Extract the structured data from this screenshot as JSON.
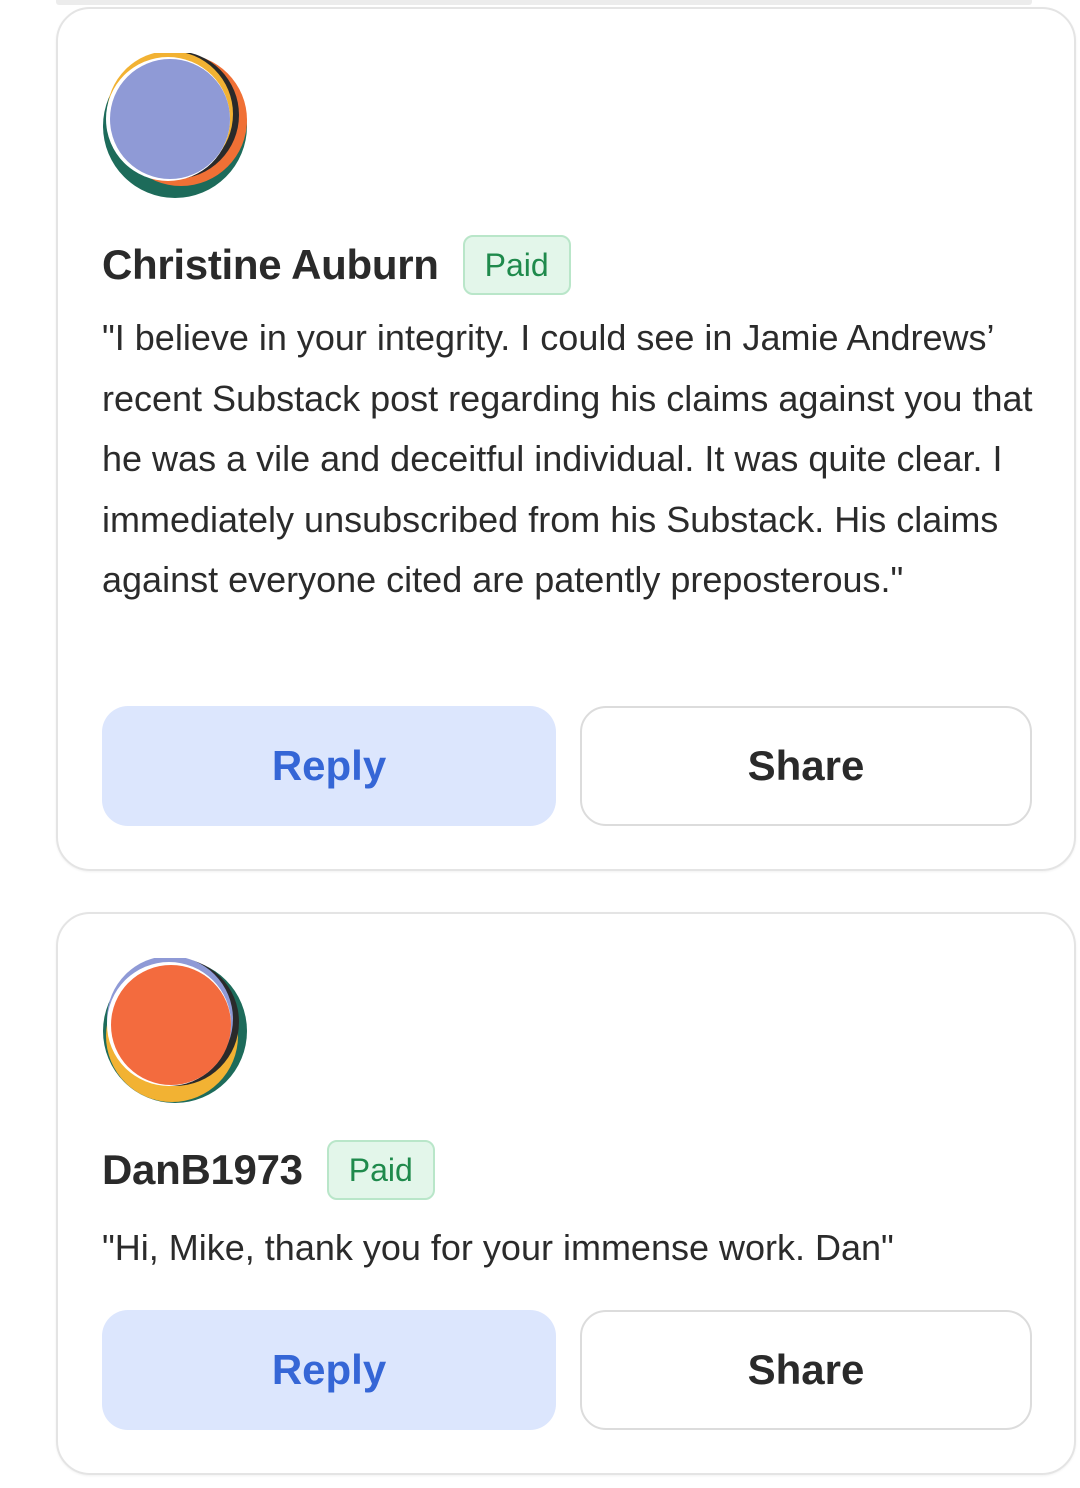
{
  "comments": [
    {
      "author": "Christine Auburn",
      "badge": "Paid",
      "avatar_icon": "avatar-blue-orange-icon",
      "avatar_colors": {
        "main": "#8f9ad6",
        "ring": "#f2b233",
        "accent": "#f07035",
        "shadow": "#1d6b5a"
      },
      "text": "\"I believe in your integrity. I could see in Jamie Andrews’ recent Substack post regarding his claims against you that he was a vile and deceitful individual. It was quite clear. I immediately unsubscribed from his Substack. His claims against everyone cited are patently preposterous.\"",
      "reply_label": "Reply",
      "share_label": "Share"
    },
    {
      "author": "DanB1973",
      "badge": "Paid",
      "avatar_icon": "avatar-orange-yellow-icon",
      "avatar_colors": {
        "main": "#f36b3e",
        "ring": "#f2b233",
        "accent": "#8f9ad6",
        "shadow": "#1d6b5a"
      },
      "text": "\"Hi, Mike, thank you for your immense work. Dan\"",
      "reply_label": "Reply",
      "share_label": "Share"
    }
  ],
  "colors": {
    "badge_text": "#1f8a4c",
    "badge_bg": "#e3f6ea",
    "reply_bg": "#dce6fd",
    "reply_text": "#3566d6"
  }
}
